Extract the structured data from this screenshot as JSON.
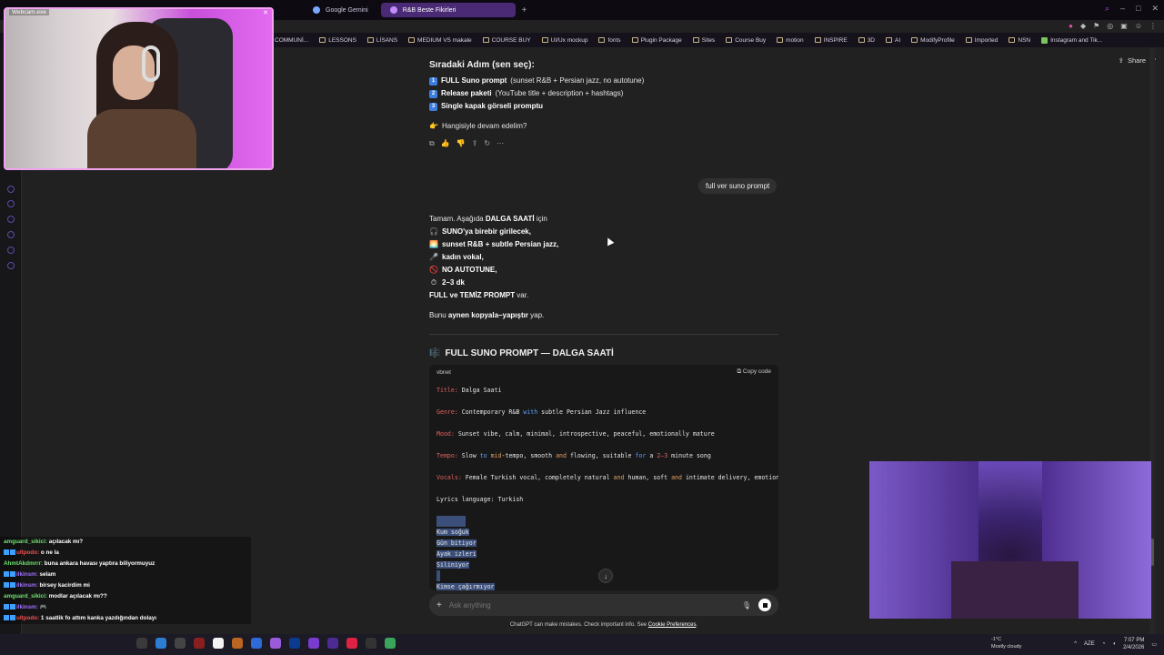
{
  "browser": {
    "tabs": [
      {
        "label": "Google Gemini",
        "active": false
      },
      {
        "label": "R&B Beste Fikirleri",
        "active": true
      }
    ],
    "new_tab": "+",
    "bookmarks": [
      "COMMUNİ...",
      "LESSONS",
      "LİSANS",
      "MEDIUM VS makale",
      "COURSE BUY",
      "UI/Ux mockup",
      "fonts",
      "Plugin Package",
      "Sites",
      "Course Buy",
      "motion",
      "INSPIRE",
      "3D",
      "AI",
      "ModifyProfile",
      "Imported",
      "NSN",
      "Instagram and Tik..."
    ]
  },
  "header": {
    "share_label": "Share"
  },
  "prev_response": {
    "heading": "Sıradaki Adım (sen seç):",
    "options": [
      {
        "num": "1",
        "bold": "FULL Suno prompt",
        "rest": " (sunset R&B + Persian jazz, no autotune)"
      },
      {
        "num": "2",
        "bold": "Release paketi",
        "rest": " (YouTube title + description + hashtags)"
      },
      {
        "num": "3",
        "bold": "Single kapak görseli promptu",
        "rest": ""
      }
    ],
    "question": "Hangisiyle devam edelim?",
    "question_emoji": "👉"
  },
  "user_message": "full ver suno prompt",
  "response": {
    "intro_pre": "Tamam. Aşağıda ",
    "intro_bold": "DALGA SAATİ",
    "intro_post": " için",
    "bullets": [
      {
        "emoji": "🎧",
        "text": "SUNO'ya birebir girilecek,"
      },
      {
        "emoji": "🌅",
        "text": "sunset R&B + subtle Persian jazz,"
      },
      {
        "emoji": "🎤",
        "text": "kadın vokal,"
      },
      {
        "emoji": "🚫",
        "text": "NO AUTOTUNE,"
      },
      {
        "emoji": "⏱",
        "text": "2–3 dk"
      }
    ],
    "summary_bold": "FULL ve TEMİZ PROMPT",
    "summary_rest": " var.",
    "copy_pre": "Bunu ",
    "copy_bold": "aynen kopyala–yapıştır",
    "copy_post": " yap.",
    "section_emoji": "🎼",
    "section_title": "FULL SUNO PROMPT — DALGA SAATİ"
  },
  "code_block": {
    "lang": "vbnet",
    "copy_label": "Copy code",
    "title_key": "Title:",
    "title_val": " Dalga Saati",
    "genre_key": "Genre:",
    "genre_a": " Contemporary R&B ",
    "genre_with": "with",
    "genre_b": " subtle Persian Jazz influence",
    "mood_key": "Mood:",
    "mood_val": " Sunset vibe, calm, minimal, introspective, peaceful, emotionally mature",
    "tempo_key": "Tempo:",
    "tempo_a": " Slow ",
    "tempo_to": "to",
    "tempo_mid": "mid",
    "tempo_b": "-tempo, smooth ",
    "tempo_and": "and",
    "tempo_c": " flowing, suitable ",
    "tempo_for": "for",
    "tempo_d": " a ",
    "tempo_range": "2–3",
    "tempo_e": " minute song",
    "vocals_key": "Vocals:",
    "vocals_a": " Female Turkish vocal, completely natural ",
    "vocals_and1": "and",
    "vocals_b": " human, soft ",
    "vocals_and2": "and",
    "vocals_c": " intimate delivery, emotional",
    "lyrics_lang": "Lyrics language: Turkish",
    "lyrics": [
      "Kum soğuk",
      "Gün bitiyor",
      "Ayak izleri",
      "Siliniyor",
      "",
      "Kimse çağırmıyor"
    ]
  },
  "composer": {
    "placeholder": "Ask anything"
  },
  "disclaimer": {
    "text": "ChatGPT can make mistakes. Check important info. See ",
    "link": "Cookie Preferences",
    "end": "."
  },
  "webcam": {
    "title": "Webcam.exe"
  },
  "stream_chat": [
    {
      "user": "amguard_sikici:",
      "text": " açılacak mı?",
      "color": "u1",
      "badges": 0
    },
    {
      "user": "ultpodo:",
      "text": " o ne la",
      "color": "u3",
      "badges": 2
    },
    {
      "user": "AhmtAkdmrrr:",
      "text": " buna ankara havası yaptıra biliyormuyuz",
      "color": "u1",
      "badges": 0
    },
    {
      "user": "ilkinsm:",
      "text": " selam",
      "color": "u2",
      "badges": 2
    },
    {
      "user": "ilkinsm:",
      "text": " birsey kacirdim mi",
      "color": "u2",
      "badges": 2
    },
    {
      "user": "amguard_sikici:",
      "text": " modlar açılacak mı??",
      "color": "u1",
      "badges": 0
    },
    {
      "user": "ilkinsm:",
      "text": " 🎮",
      "color": "u2",
      "badges": 2
    },
    {
      "user": "ultpodo:",
      "text": " 1 saatlik fo attım kanka yazdığından dolayı",
      "color": "u3",
      "badges": 2
    }
  ],
  "taskbar": {
    "weather_temp": "-1°C",
    "weather_desc": "Mostly cloudy",
    "lang": "AZE",
    "time": "7:07 PM",
    "date": "2/4/2026"
  }
}
